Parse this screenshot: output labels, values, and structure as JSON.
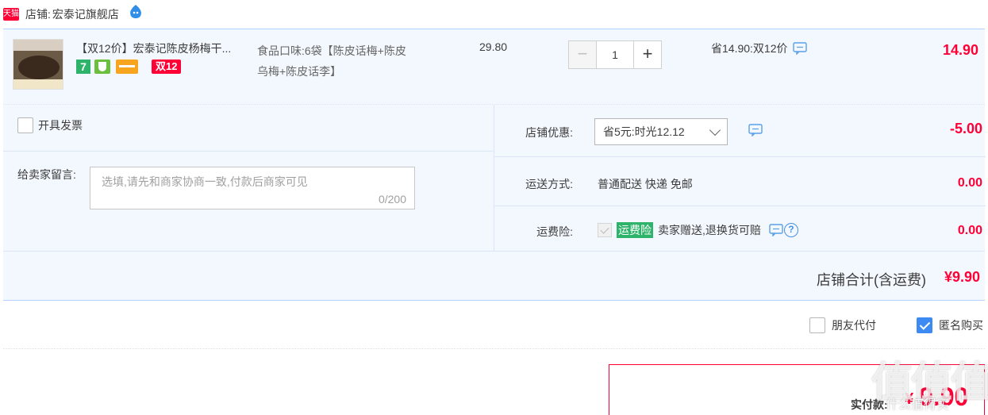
{
  "shop": {
    "badge": "天猫",
    "label": "店铺:",
    "name": "宏泰记旗舰店"
  },
  "item": {
    "title": "【双12价】宏泰记陈皮杨梅干...",
    "badges": {
      "seven": "7",
      "double12": "双12"
    },
    "sku_line1": "食品口味:6袋【陈皮话梅+陈皮",
    "sku_line2": "乌梅+陈皮话李】",
    "unit_price": "29.80",
    "quantity": "1",
    "minus": "−",
    "plus": "+",
    "promo": "省14.90:双12价",
    "subtotal": "14.90"
  },
  "invoice": {
    "label": "开具发票",
    "checked": false
  },
  "message": {
    "label": "给卖家留言:",
    "placeholder": "选填,请先和商家协商一致,付款后商家可见",
    "count": "0/200"
  },
  "shop_discount": {
    "label": "店铺优惠:",
    "selected": "省5元:时光12.12",
    "amount": "-5.00"
  },
  "shipping": {
    "label": "运送方式:",
    "value": "普通配送 快递 免邮",
    "amount": "0.00"
  },
  "insurance": {
    "label": "运费险:",
    "tag": "运费险",
    "text": "卖家赠送,退换货可赔",
    "help": "?",
    "amount": "0.00"
  },
  "shop_total": {
    "label": "店铺合计(含运费)",
    "amount": "¥9.90"
  },
  "options": {
    "friend_pay": "朋友代付",
    "anonymous": "匿名购买",
    "friend_checked": false,
    "anonymous_checked": true
  },
  "payment": {
    "label": "实付款:",
    "symbol": "¥",
    "amount": "9.90"
  },
  "watermark": {
    "big": "值值值",
    "small": "什么值得买"
  },
  "colors": {
    "price_red": "#ff0036",
    "panel_bg": "#f3f8fe",
    "border_blue": "#b2d1ff",
    "check_blue": "#3d8bf2",
    "insurance_green": "#2eb46a"
  },
  "icons": [
    "tmall-badge-icon",
    "wangwang-icon",
    "chat-icon",
    "help-icon",
    "chevron-down-icon"
  ]
}
